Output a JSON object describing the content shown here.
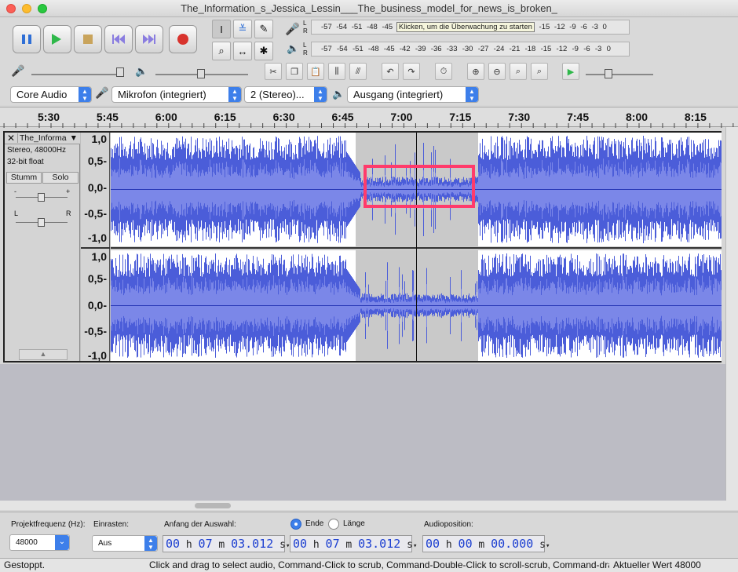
{
  "window": {
    "title": "The_Information_s_Jessica_Lessin___The_business_model_for_news_is_broken_"
  },
  "colors": {
    "waveform": "#4b5dd9",
    "waveform_light": "#7b87e8",
    "selection_bg": "#c9c9c9",
    "highlight_box": "#ff3b6b"
  },
  "transport": {
    "buttons": [
      "pause",
      "play",
      "stop",
      "skip-to-start",
      "skip-to-end",
      "record"
    ]
  },
  "tools": [
    "selection-tool",
    "envelope-tool",
    "draw-tool",
    "zoom-tool",
    "time-shift-tool",
    "multi-tool"
  ],
  "meters": {
    "record_scale": "-57 -54 -51 -48 -45",
    "record_tooltip": "Klicken, um die Überwachung zu starten",
    "record_scale_end": "-15 -12 -9 -6 -3 0",
    "playback_scale": "-57 -54 -51 -48 -45 -42 -39 -36 -33 -30 -27 -24 -21 -18 -15 -12 -9 -6 -3 0",
    "channel_l": "L",
    "channel_r": "R"
  },
  "devices": {
    "host": "Core Audio",
    "input": "Mikrofon (integriert)",
    "channels": "2 (Stereo)...",
    "output": "Ausgang (integriert)"
  },
  "ruler": {
    "ticks": [
      "5:30",
      "5:45",
      "6:00",
      "6:15",
      "6:30",
      "6:45",
      "7:00",
      "7:15",
      "7:30",
      "7:45",
      "8:00",
      "8:15"
    ]
  },
  "track": {
    "name": "The_Informa",
    "format": "Stereo, 48000Hz",
    "bits": "32-bit float",
    "mute": "Stumm",
    "solo": "Solo",
    "gain_minus": "-",
    "gain_plus": "+",
    "pan_l": "L",
    "pan_r": "R",
    "y_labels": [
      "1,0",
      "0,5-",
      "0,0-",
      "-0,5-",
      "-1,0"
    ]
  },
  "footer": {
    "rate_label": "Projektfrequenz (Hz):",
    "rate_value": "48000",
    "snap_label": "Einrasten:",
    "snap_value": "Aus",
    "sel_start_label": "Anfang der Auswahl:",
    "end_label": "Ende",
    "length_label": "Länge",
    "audio_pos_label": "Audioposition:",
    "start_time": {
      "h": "00",
      "m": "07",
      "s": "03.012"
    },
    "end_time": {
      "h": "00",
      "m": "07",
      "s": "03.012"
    },
    "audio_time": {
      "h": "00",
      "m": "00",
      "s": "00.000"
    }
  },
  "status": {
    "state": "Gestoppt.",
    "hint": "Click and drag to select audio, Command-Click to scrub, Command-Double-Click to scroll-scrub, Command-dra",
    "value": "Aktueller Wert 48000"
  }
}
